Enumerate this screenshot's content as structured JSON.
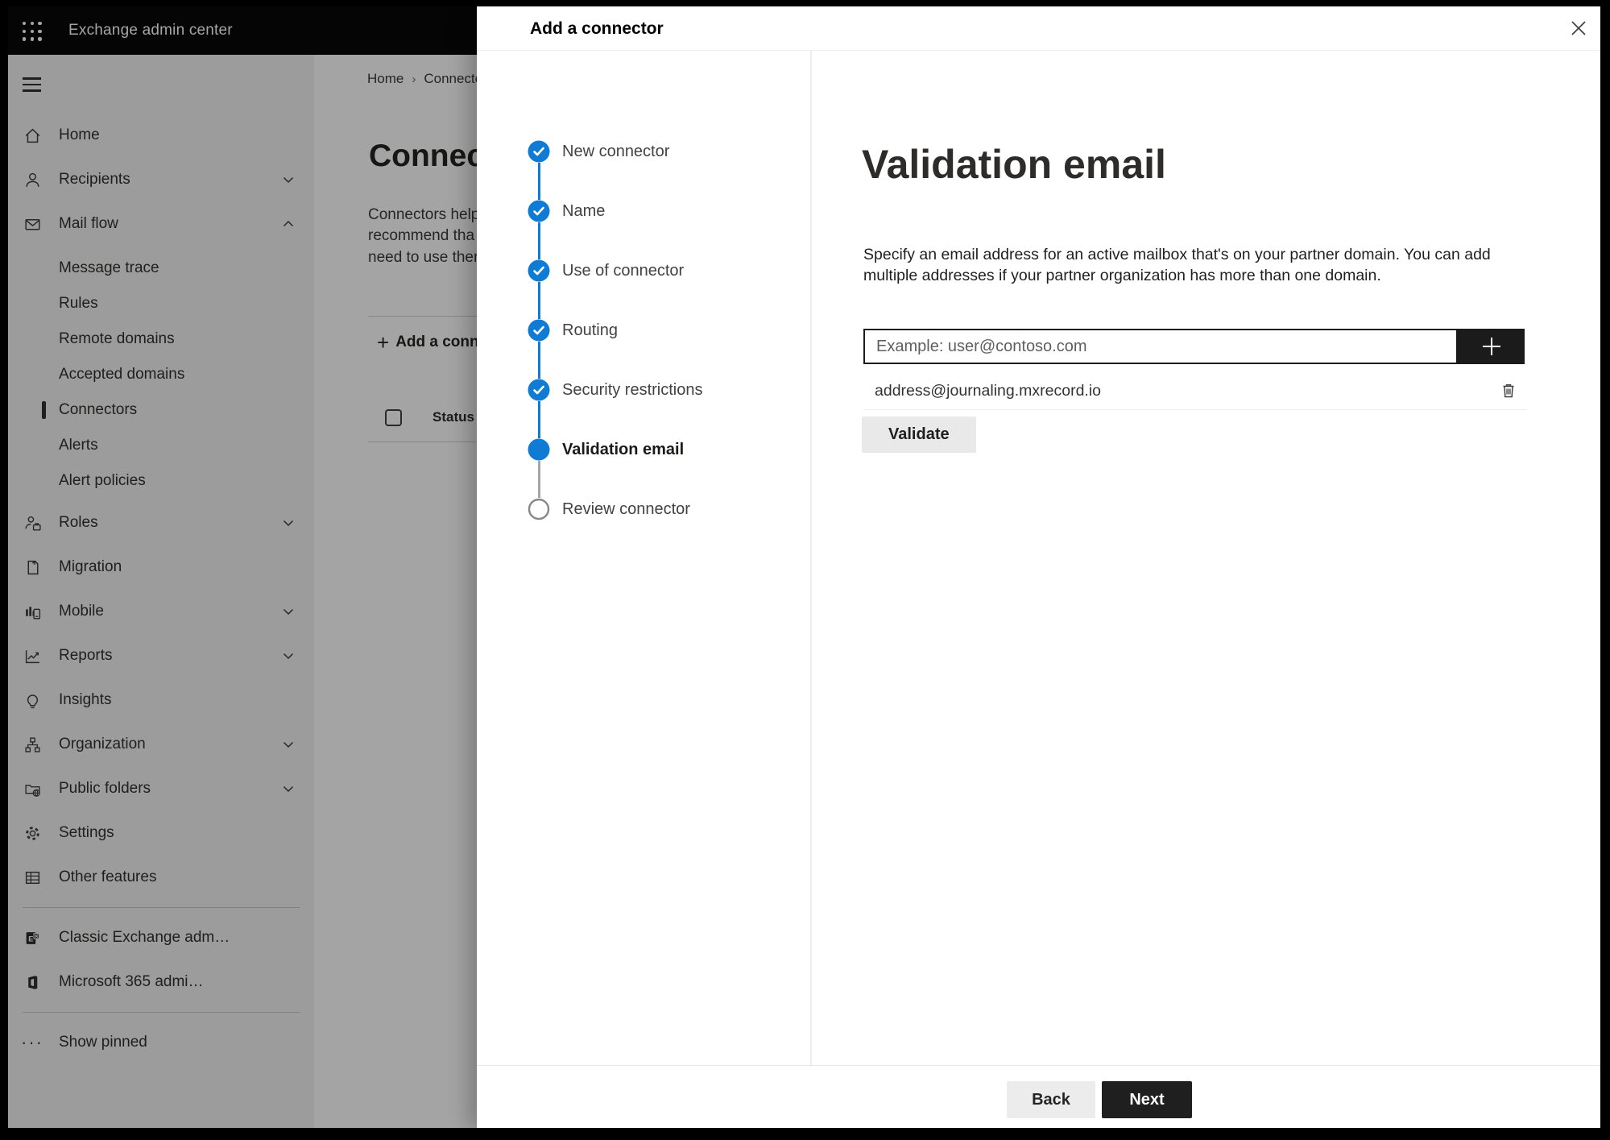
{
  "app": {
    "title": "Exchange admin center"
  },
  "colors": {
    "accent_blue": "#0f7bd4",
    "topbar": "#090909",
    "dark_button": "#1b1b1b",
    "light_button": "#e9e9e9"
  },
  "sidebar": {
    "items": [
      {
        "label": "Home",
        "icon": "home-icon",
        "chevron": null,
        "type": "top"
      },
      {
        "label": "Recipients",
        "icon": "person-icon",
        "chevron": "down",
        "type": "top"
      },
      {
        "label": "Mail flow",
        "icon": "mail-icon",
        "chevron": "up",
        "type": "top"
      },
      {
        "label": "Message trace",
        "icon": null,
        "chevron": null,
        "type": "sub"
      },
      {
        "label": "Rules",
        "icon": null,
        "chevron": null,
        "type": "sub"
      },
      {
        "label": "Remote domains",
        "icon": null,
        "chevron": null,
        "type": "sub"
      },
      {
        "label": "Accepted domains",
        "icon": null,
        "chevron": null,
        "type": "sub"
      },
      {
        "label": "Connectors",
        "icon": null,
        "chevron": null,
        "type": "sub",
        "selected": true
      },
      {
        "label": "Alerts",
        "icon": null,
        "chevron": null,
        "type": "sub"
      },
      {
        "label": "Alert policies",
        "icon": null,
        "chevron": null,
        "type": "sub",
        "last_sub": true
      },
      {
        "label": "Roles",
        "icon": "roles-icon",
        "chevron": "down",
        "type": "top"
      },
      {
        "label": "Migration",
        "icon": "migration-icon",
        "chevron": null,
        "type": "top"
      },
      {
        "label": "Mobile",
        "icon": "mobile-icon",
        "chevron": "down",
        "type": "top"
      },
      {
        "label": "Reports",
        "icon": "reports-icon",
        "chevron": "down",
        "type": "top"
      },
      {
        "label": "Insights",
        "icon": "insights-icon",
        "chevron": null,
        "type": "top"
      },
      {
        "label": "Organization",
        "icon": "organization-icon",
        "chevron": "down",
        "type": "top"
      },
      {
        "label": "Public folders",
        "icon": "public-folders-icon",
        "chevron": "down",
        "type": "top"
      },
      {
        "label": "Settings",
        "icon": "settings-icon",
        "chevron": null,
        "type": "top"
      },
      {
        "label": "Other features",
        "icon": "other-features-icon",
        "chevron": null,
        "type": "top",
        "divider_after": true
      },
      {
        "label": "Classic Exchange adm…",
        "icon": "classic-exchange-icon",
        "chevron": null,
        "type": "top"
      },
      {
        "label": "Microsoft 365 admi…",
        "icon": "microsoft-365-icon",
        "chevron": null,
        "type": "top",
        "divider_after": true
      },
      {
        "label": "Show pinned",
        "icon": "ellipsis-icon",
        "chevron": null,
        "type": "top"
      }
    ]
  },
  "page": {
    "breadcrumb": {
      "item1": "Home",
      "item2": "Connectors"
    },
    "title": "Connectors",
    "paragraph_lines": [
      "Connectors help",
      "recommend tha",
      "need to use ther"
    ],
    "add_button_label": "Add a conn",
    "status_column": "Status"
  },
  "flyout": {
    "title": "Add a connector",
    "steps": [
      {
        "label": "New connector",
        "state": "done"
      },
      {
        "label": "Name",
        "state": "done"
      },
      {
        "label": "Use of connector",
        "state": "done"
      },
      {
        "label": "Routing",
        "state": "done"
      },
      {
        "label": "Security restrictions",
        "state": "done"
      },
      {
        "label": "Validation email",
        "state": "current"
      },
      {
        "label": "Review connector",
        "state": "todo"
      }
    ],
    "content": {
      "title": "Validation email",
      "description_line1": "Specify an email address for an active mailbox that's on your partner domain. You can add",
      "description_line2": "multiple addresses if your partner organization has more than one domain.",
      "input_placeholder": "Example: user@contoso.com",
      "addresses": [
        "address@journaling.mxrecord.io"
      ],
      "validate_label": "Validate"
    },
    "footer": {
      "back_label": "Back",
      "next_label": "Next"
    }
  }
}
